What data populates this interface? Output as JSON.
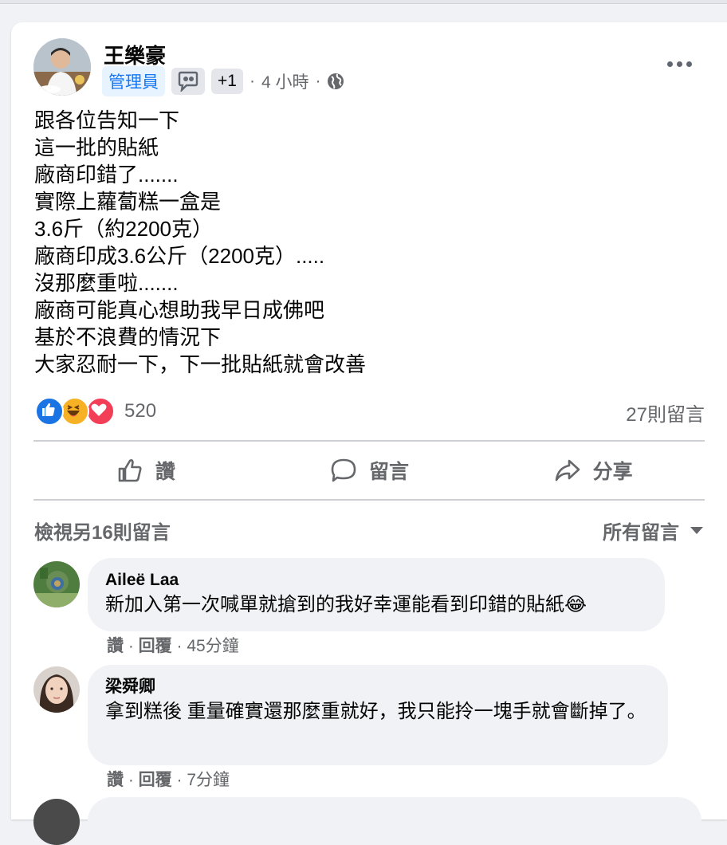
{
  "post": {
    "author": "王樂豪",
    "badge_admin": "管理員",
    "badge_plus": "+1",
    "time": "4 小時",
    "separator": "·",
    "body": "跟各位告知一下\n這一批的貼紙\n廠商印錯了.......\n實際上蘿蔔糕一盒是\n3.6斤（約2200克）\n廠商印成3.6公斤（2200克）.....\n沒那麼重啦.......\n廠商可能真心想助我早日成佛吧\n基於不浪費的情況下\n大家忍耐一下，下一批貼紙就會改善",
    "reaction_count": "520",
    "comment_count": "27則留言"
  },
  "actions": {
    "like": "讚",
    "comment": "留言",
    "share": "分享"
  },
  "comments_section": {
    "view_more": "檢視另16則留言",
    "sort": "所有留言"
  },
  "comments": [
    {
      "name": "Aileë Laa",
      "text": "新加入第一次喊單就搶到的我好幸運能看到印錯的貼紙😂",
      "like": "讚",
      "reply": "回覆",
      "time": "45分鐘"
    },
    {
      "name": "梁舜卿",
      "text": "拿到糕後 重量確實還那麼重就好，我只能拎一塊手就會斷掉了。",
      "like": "讚",
      "reply": "回覆",
      "time": "7分鐘"
    }
  ],
  "colors": {
    "accent_blue": "#1877f2",
    "secondary_text": "#65676b",
    "like_blue": "#1b74e4",
    "haha_yellow": "#f7b125",
    "love_red": "#f33e58"
  }
}
